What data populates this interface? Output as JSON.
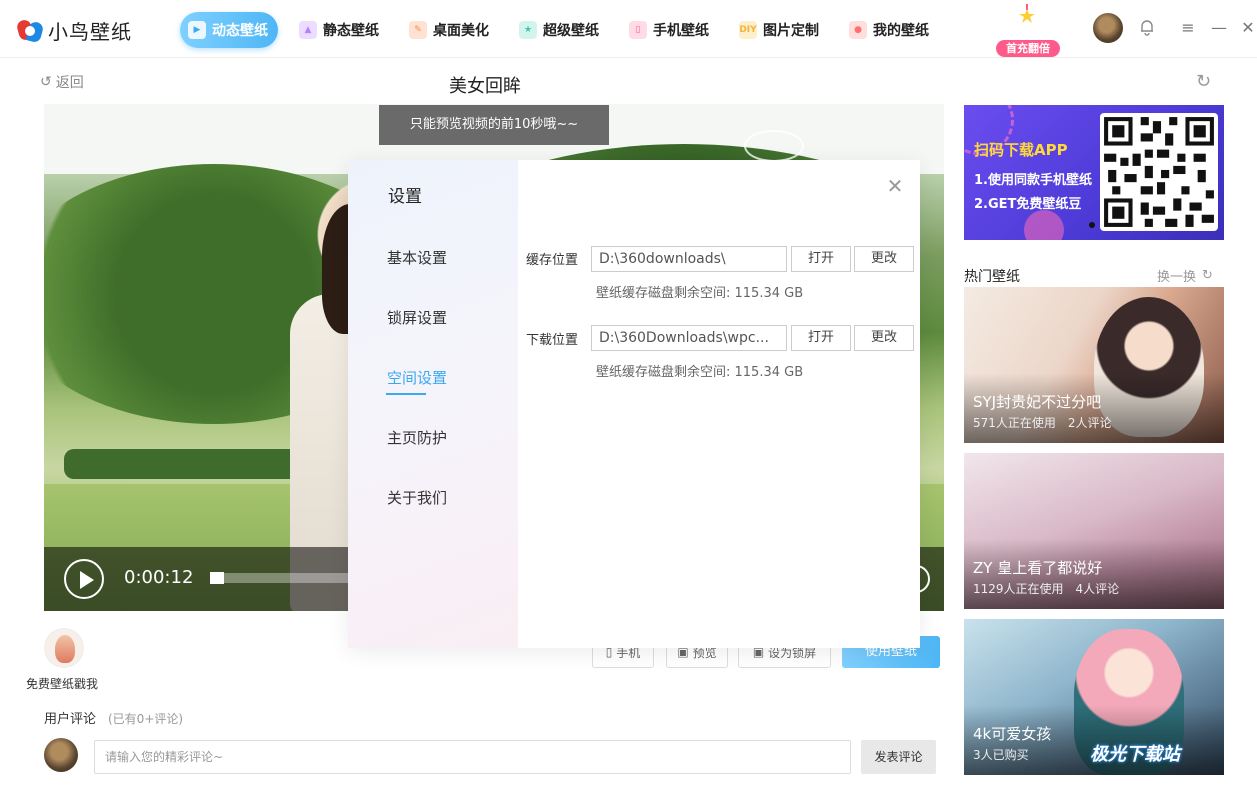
{
  "app": {
    "name": "小鸟壁纸"
  },
  "nav": {
    "tabs": [
      {
        "label": "动态壁纸",
        "icon": "video-icon",
        "color": "#ff6fa8"
      },
      {
        "label": "静态壁纸",
        "icon": "image-icon",
        "color": "#b483ff"
      },
      {
        "label": "桌面美化",
        "icon": "brush-icon",
        "color": "#ff8a4c"
      },
      {
        "label": "超级壁纸",
        "icon": "star-icon",
        "color": "#3cc9a8"
      },
      {
        "label": "手机壁纸",
        "icon": "phone-icon",
        "color": "#ff5f8c"
      },
      {
        "label": "图片定制",
        "icon": "diy-icon",
        "color": "#f5b23a",
        "icon_text": "DIY"
      },
      {
        "label": "我的壁纸",
        "icon": "user-icon",
        "color": "#ff6f6f"
      }
    ],
    "promo_label": "首充翻倍"
  },
  "subheader": {
    "back_label": "返回",
    "title": "美女回眸"
  },
  "player": {
    "preview_note": "只能预览视频的前10秒哦~~",
    "time": "0:00:12"
  },
  "actions": {
    "mascot_label": "免费壁纸戳我",
    "phone": "手机",
    "preview": "预览",
    "lockscreen": "设为锁屏",
    "use": "使用壁纸"
  },
  "comments": {
    "title": "用户评论",
    "count": "(已有0+评论)",
    "placeholder": "请输入您的精彩评论~",
    "submit": "发表评论"
  },
  "sidebar": {
    "ad": {
      "line1": "扫码下载APP",
      "line2": "1.使用同款手机壁纸",
      "line3": "2.GET免费壁纸豆"
    },
    "hot_title": "热门壁纸",
    "refresh_label": "换一换",
    "cards": [
      {
        "title": "SYJ封贵妃不过分吧",
        "users": "571人正在使用",
        "comments": "2人评论"
      },
      {
        "title": "ZY 皇上看了都说好",
        "users": "1129人正在使用",
        "comments": "4人评论"
      },
      {
        "title": "4k可爱女孩",
        "users": "3人已购买",
        "comments": ""
      }
    ],
    "watermark": "极光下载站"
  },
  "settings": {
    "title": "设置",
    "menu": [
      "基本设置",
      "锁屏设置",
      "空间设置",
      "主页防护",
      "关于我们"
    ],
    "active_index": 2,
    "cache": {
      "label": "缓存位置",
      "path": "D:\\360downloads\\",
      "open": "打开",
      "change": "更改",
      "space": "壁纸缓存磁盘剩余空间: 115.34 GB"
    },
    "download": {
      "label": "下载位置",
      "path": "D:\\360Downloads\\wpc...",
      "open": "打开",
      "change": "更改",
      "space": "壁纸缓存磁盘剩余空间: 115.34 GB"
    }
  },
  "colors": {
    "accent": "#4eb6f5",
    "active_menu": "#3ba9ef",
    "promo": "#ff5b8a"
  }
}
